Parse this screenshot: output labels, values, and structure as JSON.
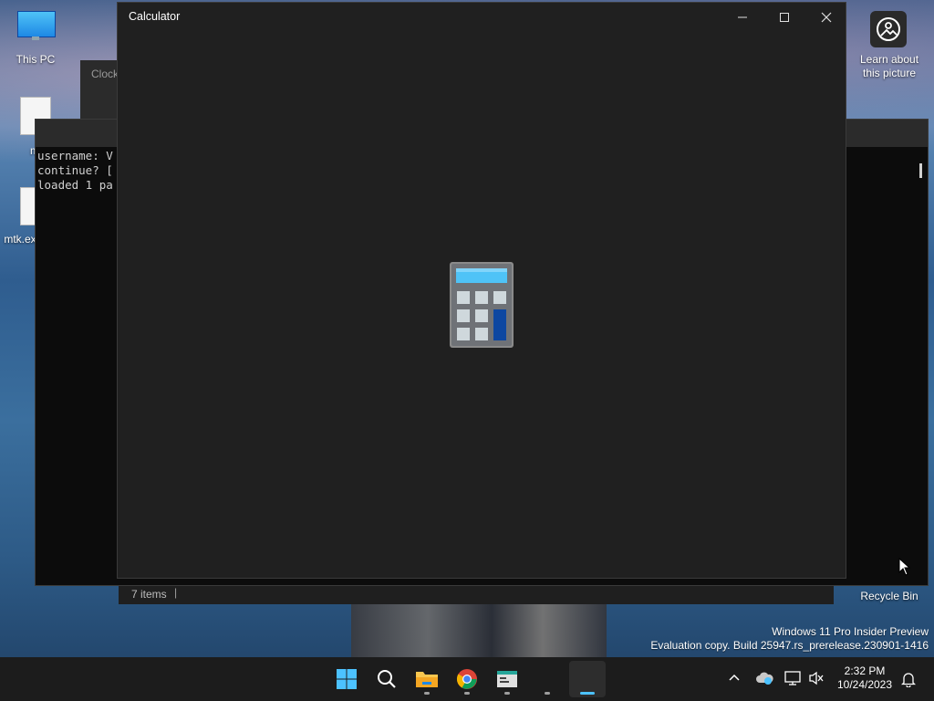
{
  "desktop": {
    "this_pc_label": "This PC",
    "file1_label": "m",
    "file2_label": "mtk.ex",
    "learn_label_line1": "Learn about",
    "learn_label_line2": "this picture",
    "recycle_bin_label": "Recycle Bin",
    "watermark_line1": "Windows 11 Pro Insider Preview",
    "watermark_line2": "Evaluation copy. Build 25947.rs_prerelease.230901-1416"
  },
  "clock_window": {
    "title": "Clock"
  },
  "explorer_window": {
    "status_items": "7 items",
    "status_sep": "|"
  },
  "console_window": {
    "lines": [
      "username: V",
      "continue? [",
      "loaded 1 pa"
    ]
  },
  "calculator": {
    "title": "Calculator",
    "minimize_glyph": "—",
    "maximize_glyph": "☐",
    "close_glyph": "✕"
  },
  "taskbar": {
    "apps": [
      {
        "name": "start",
        "icon": "windows-logo-icon"
      },
      {
        "name": "search",
        "icon": "search-icon"
      },
      {
        "name": "file-explorer",
        "icon": "folder-icon"
      },
      {
        "name": "chrome",
        "icon": "chrome-icon"
      },
      {
        "name": "app-window",
        "icon": "app-window-icon"
      },
      {
        "name": "terminal",
        "icon": "terminal-icon"
      },
      {
        "name": "calculator",
        "icon": "calculator-icon"
      }
    ],
    "tray_chevron": "^",
    "time": "2:32 PM",
    "date": "10/24/2023"
  },
  "colors": {
    "accent": "#4cc2ff",
    "calc_bg": "#202020",
    "taskbar_bg": "#1c1c1c"
  }
}
